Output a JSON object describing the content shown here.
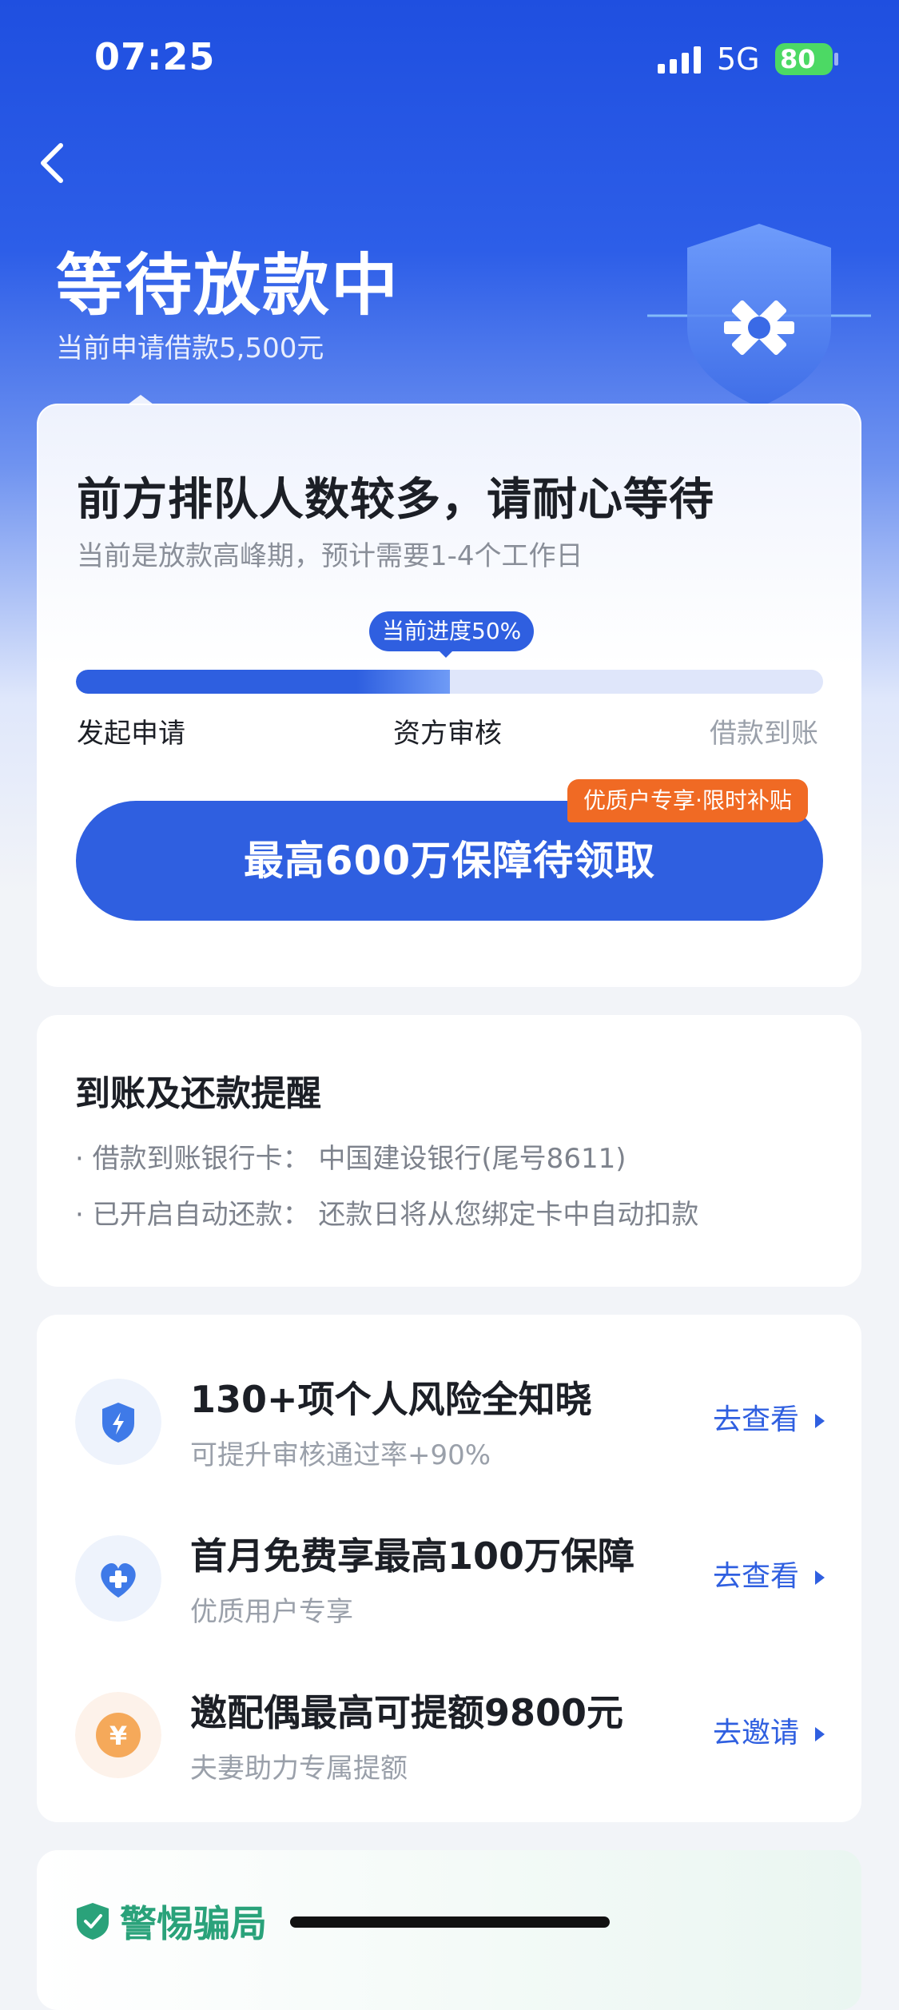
{
  "status_bar": {
    "time": "07:25",
    "network": "5G",
    "battery": "80"
  },
  "header": {
    "title": "等待放款中",
    "subtitle": "当前申请借款5,500元"
  },
  "progress_card": {
    "title": "前方排队人数较多，请耐心等待",
    "subtitle": "当前是放款高峰期，预计需要1-4个工作日",
    "progress_label": "当前进度50%",
    "progress_percent": 50,
    "steps": [
      "发起申请",
      "资方审核",
      "借款到账"
    ],
    "cta_label": "最高600万保障待领取",
    "cta_tag": "优质户专享·限时补贴"
  },
  "reminder_card": {
    "title": "到账及还款提醒",
    "lines": [
      "· 借款到账银行卡：  中国建设银行(尾号8611)",
      "· 已开启自动还款：  还款日将从您绑定卡中自动扣款"
    ]
  },
  "benefits": [
    {
      "icon": "shield-bolt-icon",
      "title": "130+项个人风险全知晓",
      "subtitle": "可提升审核通过率+90%",
      "link": "去查看"
    },
    {
      "icon": "heart-plus-icon",
      "title": "首月免费享最高100万保障",
      "subtitle": "优质用户专享",
      "link": "去查看"
    },
    {
      "icon": "yuan-coin-icon",
      "title": "邀配偶最高可提额9800元",
      "subtitle": "夫妻助力专属提额",
      "link": "去邀请"
    }
  ],
  "fraud_card": {
    "title": "警惕骗局"
  },
  "colors": {
    "primary": "#2f5fe0",
    "tag": "#f06a24",
    "safe": "#2aa27a"
  }
}
